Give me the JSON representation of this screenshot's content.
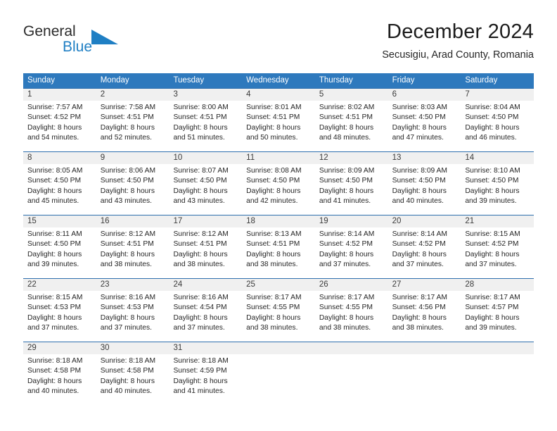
{
  "brand": {
    "word1": "General",
    "word2": "Blue",
    "triangle_color": "#1f7fc4"
  },
  "header": {
    "title": "December 2024",
    "subtitle": "Secusigiu, Arad County, Romania"
  },
  "theme": {
    "header_bg": "#2e79bd",
    "row_rule": "#2e6fae",
    "numband_bg": "#f0f0f0",
    "text": "#262626"
  },
  "weekdays": [
    "Sunday",
    "Monday",
    "Tuesday",
    "Wednesday",
    "Thursday",
    "Friday",
    "Saturday"
  ],
  "weeks": [
    [
      {
        "day": "1",
        "info": "Sunrise: 7:57 AM\nSunset: 4:52 PM\nDaylight: 8 hours\nand 54 minutes."
      },
      {
        "day": "2",
        "info": "Sunrise: 7:58 AM\nSunset: 4:51 PM\nDaylight: 8 hours\nand 52 minutes."
      },
      {
        "day": "3",
        "info": "Sunrise: 8:00 AM\nSunset: 4:51 PM\nDaylight: 8 hours\nand 51 minutes."
      },
      {
        "day": "4",
        "info": "Sunrise: 8:01 AM\nSunset: 4:51 PM\nDaylight: 8 hours\nand 50 minutes."
      },
      {
        "day": "5",
        "info": "Sunrise: 8:02 AM\nSunset: 4:51 PM\nDaylight: 8 hours\nand 48 minutes."
      },
      {
        "day": "6",
        "info": "Sunrise: 8:03 AM\nSunset: 4:50 PM\nDaylight: 8 hours\nand 47 minutes."
      },
      {
        "day": "7",
        "info": "Sunrise: 8:04 AM\nSunset: 4:50 PM\nDaylight: 8 hours\nand 46 minutes."
      }
    ],
    [
      {
        "day": "8",
        "info": "Sunrise: 8:05 AM\nSunset: 4:50 PM\nDaylight: 8 hours\nand 45 minutes."
      },
      {
        "day": "9",
        "info": "Sunrise: 8:06 AM\nSunset: 4:50 PM\nDaylight: 8 hours\nand 43 minutes."
      },
      {
        "day": "10",
        "info": "Sunrise: 8:07 AM\nSunset: 4:50 PM\nDaylight: 8 hours\nand 43 minutes."
      },
      {
        "day": "11",
        "info": "Sunrise: 8:08 AM\nSunset: 4:50 PM\nDaylight: 8 hours\nand 42 minutes."
      },
      {
        "day": "12",
        "info": "Sunrise: 8:09 AM\nSunset: 4:50 PM\nDaylight: 8 hours\nand 41 minutes."
      },
      {
        "day": "13",
        "info": "Sunrise: 8:09 AM\nSunset: 4:50 PM\nDaylight: 8 hours\nand 40 minutes."
      },
      {
        "day": "14",
        "info": "Sunrise: 8:10 AM\nSunset: 4:50 PM\nDaylight: 8 hours\nand 39 minutes."
      }
    ],
    [
      {
        "day": "15",
        "info": "Sunrise: 8:11 AM\nSunset: 4:50 PM\nDaylight: 8 hours\nand 39 minutes."
      },
      {
        "day": "16",
        "info": "Sunrise: 8:12 AM\nSunset: 4:51 PM\nDaylight: 8 hours\nand 38 minutes."
      },
      {
        "day": "17",
        "info": "Sunrise: 8:12 AM\nSunset: 4:51 PM\nDaylight: 8 hours\nand 38 minutes."
      },
      {
        "day": "18",
        "info": "Sunrise: 8:13 AM\nSunset: 4:51 PM\nDaylight: 8 hours\nand 38 minutes."
      },
      {
        "day": "19",
        "info": "Sunrise: 8:14 AM\nSunset: 4:52 PM\nDaylight: 8 hours\nand 37 minutes."
      },
      {
        "day": "20",
        "info": "Sunrise: 8:14 AM\nSunset: 4:52 PM\nDaylight: 8 hours\nand 37 minutes."
      },
      {
        "day": "21",
        "info": "Sunrise: 8:15 AM\nSunset: 4:52 PM\nDaylight: 8 hours\nand 37 minutes."
      }
    ],
    [
      {
        "day": "22",
        "info": "Sunrise: 8:15 AM\nSunset: 4:53 PM\nDaylight: 8 hours\nand 37 minutes."
      },
      {
        "day": "23",
        "info": "Sunrise: 8:16 AM\nSunset: 4:53 PM\nDaylight: 8 hours\nand 37 minutes."
      },
      {
        "day": "24",
        "info": "Sunrise: 8:16 AM\nSunset: 4:54 PM\nDaylight: 8 hours\nand 37 minutes."
      },
      {
        "day": "25",
        "info": "Sunrise: 8:17 AM\nSunset: 4:55 PM\nDaylight: 8 hours\nand 38 minutes."
      },
      {
        "day": "26",
        "info": "Sunrise: 8:17 AM\nSunset: 4:55 PM\nDaylight: 8 hours\nand 38 minutes."
      },
      {
        "day": "27",
        "info": "Sunrise: 8:17 AM\nSunset: 4:56 PM\nDaylight: 8 hours\nand 38 minutes."
      },
      {
        "day": "28",
        "info": "Sunrise: 8:17 AM\nSunset: 4:57 PM\nDaylight: 8 hours\nand 39 minutes."
      }
    ],
    [
      {
        "day": "29",
        "info": "Sunrise: 8:18 AM\nSunset: 4:58 PM\nDaylight: 8 hours\nand 40 minutes."
      },
      {
        "day": "30",
        "info": "Sunrise: 8:18 AM\nSunset: 4:58 PM\nDaylight: 8 hours\nand 40 minutes."
      },
      {
        "day": "31",
        "info": "Sunrise: 8:18 AM\nSunset: 4:59 PM\nDaylight: 8 hours\nand 41 minutes."
      },
      {
        "day": "",
        "info": ""
      },
      {
        "day": "",
        "info": ""
      },
      {
        "day": "",
        "info": ""
      },
      {
        "day": "",
        "info": ""
      }
    ]
  ]
}
